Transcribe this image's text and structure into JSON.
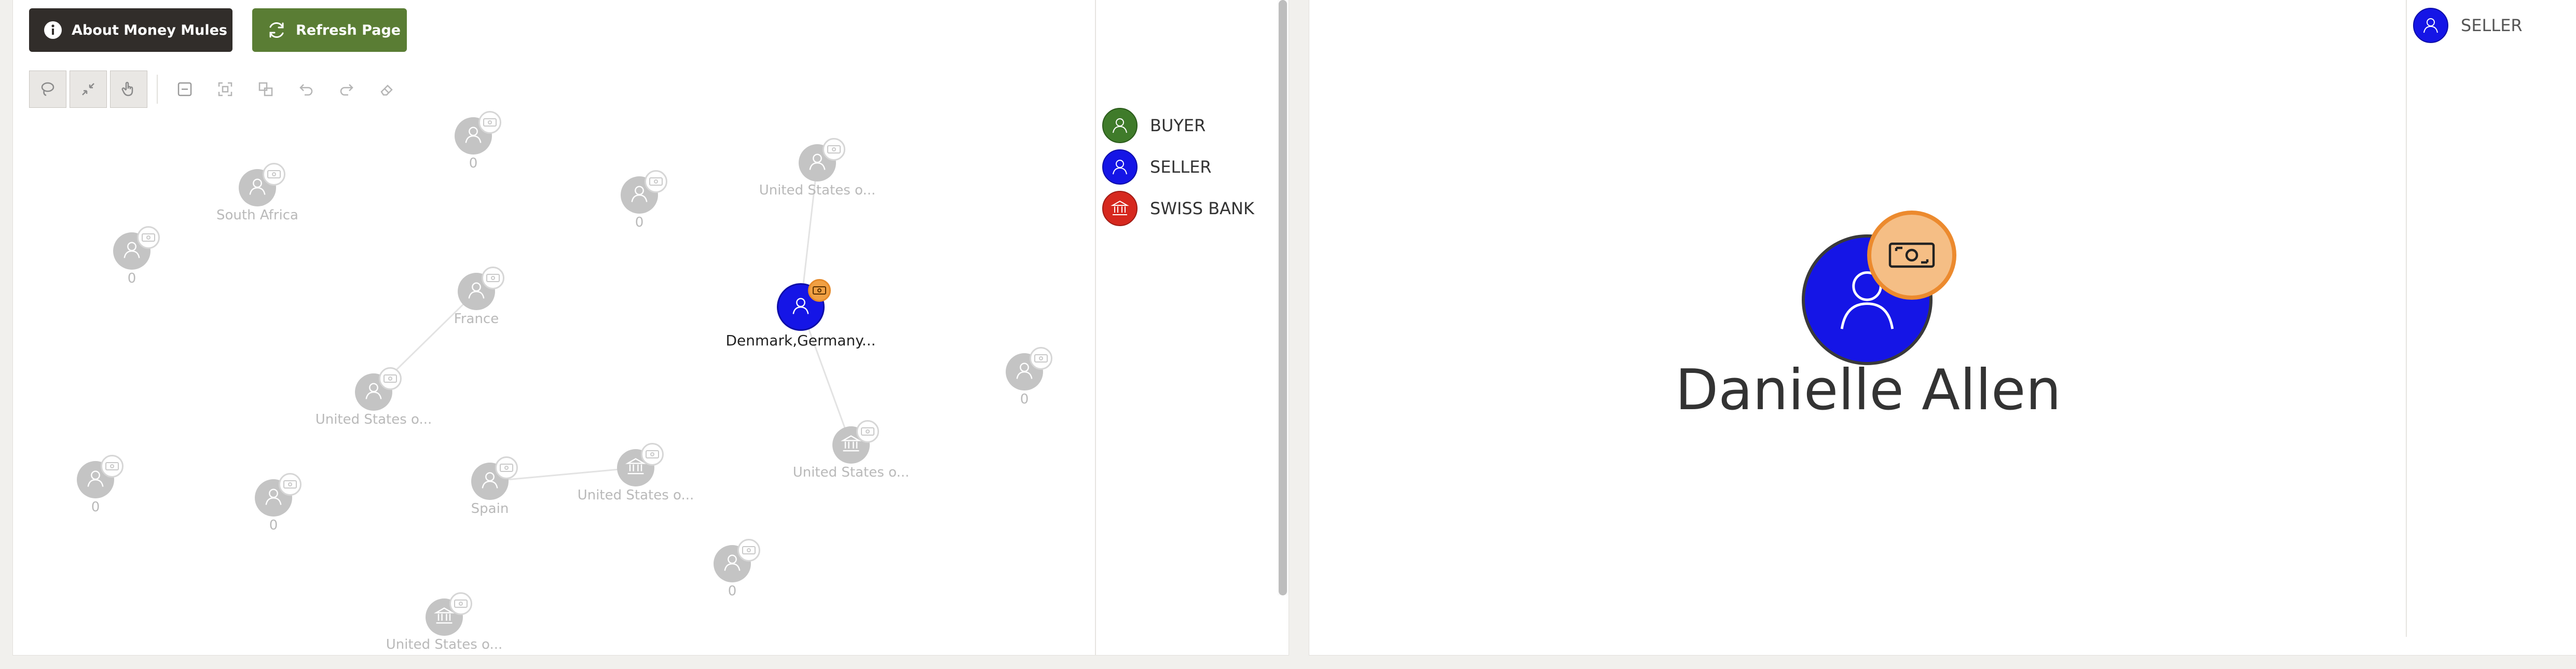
{
  "toolbar": {
    "about_label": "About Money Mules",
    "refresh_label": "Refresh Page"
  },
  "graph_tools": [
    "lasso-icon",
    "collapse-icon",
    "hand-pointer-icon",
    "zoom-out-icon",
    "fit-icon",
    "layers-icon",
    "undo-icon",
    "redo-icon",
    "eraser-icon"
  ],
  "graph": {
    "nodes": [
      {
        "label": "0",
        "kind": "person"
      },
      {
        "label": "South Africa",
        "kind": "person"
      },
      {
        "label": "0",
        "kind": "person"
      },
      {
        "label": "0",
        "kind": "person"
      },
      {
        "label": "United States o...",
        "kind": "person"
      },
      {
        "label": "France",
        "kind": "person"
      },
      {
        "label": "Denmark,Germany...",
        "kind": "seller",
        "highlighted": true
      },
      {
        "label": "United States o...",
        "kind": "person"
      },
      {
        "label": "0",
        "kind": "person"
      },
      {
        "label": "United States o...",
        "kind": "bank"
      },
      {
        "label": "0",
        "kind": "person"
      },
      {
        "label": "0",
        "kind": "person"
      },
      {
        "label": "Spain",
        "kind": "person"
      },
      {
        "label": "United States o...",
        "kind": "bank"
      },
      {
        "label": "0",
        "kind": "person"
      },
      {
        "label": "United States o...",
        "kind": "bank"
      }
    ]
  },
  "legend": [
    {
      "label": "BUYER",
      "color": "#3f7b2a",
      "icon": "person-icon"
    },
    {
      "label": "SELLER",
      "color": "#1515e6",
      "icon": "person-icon"
    },
    {
      "label": "SWISS BANK",
      "color": "#d6281e",
      "icon": "bank-icon"
    }
  ],
  "right_legend": [
    {
      "label": "SELLER",
      "color": "#1515e6",
      "icon": "person-icon"
    }
  ],
  "profile": {
    "name": "Danielle Allen",
    "role_color": "#1515e6",
    "badge_color": "#f5be85",
    "badge_border": "#ec8a2e",
    "badge_icon": "banknote-icon"
  },
  "colors": {
    "buyer": "#3f7b2a",
    "seller": "#1515e6",
    "swiss_bank": "#d6281e",
    "dimmed_node": "#c4c4c4",
    "highlight_badge": "#f0a043"
  }
}
